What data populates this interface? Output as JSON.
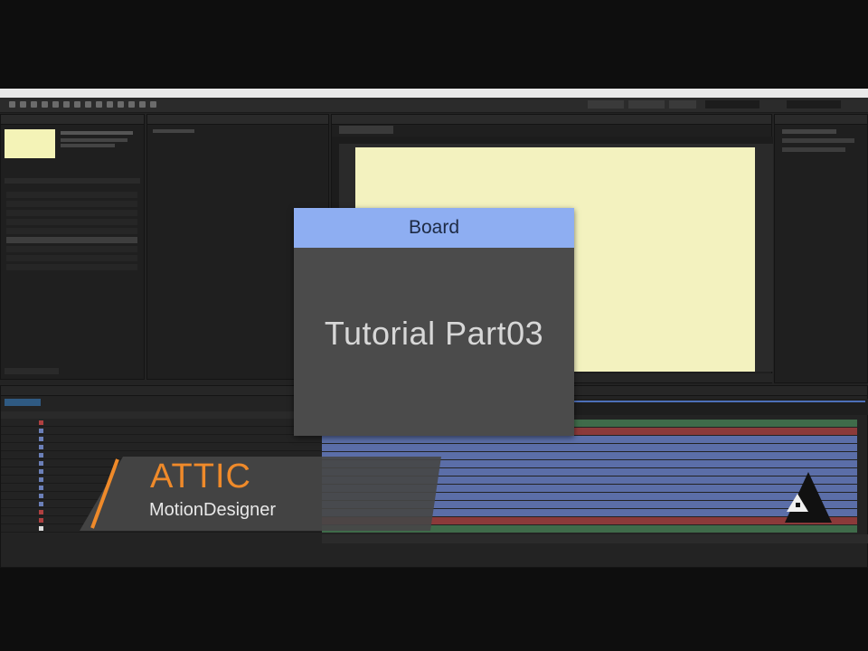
{
  "overlay": {
    "board_title": "Board",
    "tutorial_title": "Tutorial Part03",
    "brand_name": "ATTIC",
    "brand_subtitle": "MotionDesigner"
  },
  "colors": {
    "board_header": "#8eaef2",
    "composition_bg": "#f3f2bf",
    "brand_orange": "#ef8a2a",
    "track_blue": "#5b6ea8",
    "track_red": "#8b3a3a",
    "track_green": "#3f6b4a"
  },
  "icons": [
    "slash-icon",
    "triangle-logo-icon"
  ]
}
